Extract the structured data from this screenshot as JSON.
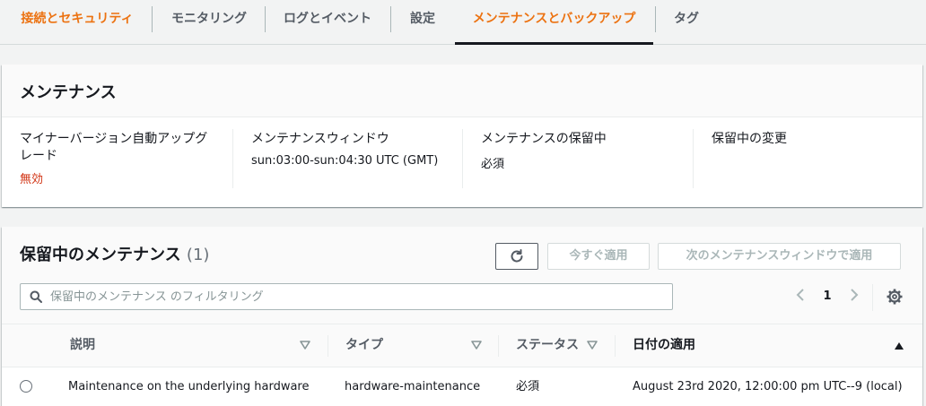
{
  "tabs": [
    {
      "label": "接続とセキュリティ"
    },
    {
      "label": "モニタリング"
    },
    {
      "label": "ログとイベント"
    },
    {
      "label": "設定"
    },
    {
      "label": "メンテナンスとバックアップ"
    },
    {
      "label": "タグ"
    }
  ],
  "maintenance": {
    "title": "メンテナンス",
    "fields": [
      {
        "label": "マイナーバージョン自動アップグレード",
        "label_line1": "マイナーバージョン自動アップグ",
        "label_line2": "レード",
        "value": "無効"
      },
      {
        "label": "メンテナンスウィンドウ",
        "value": "sun:03:00-sun:04:30 UTC (GMT)"
      },
      {
        "label": "メンテナンスの保留中",
        "value": "必須"
      },
      {
        "label": "保留中の変更",
        "value": ""
      }
    ]
  },
  "pending": {
    "title": "保留中のメンテナンス",
    "count": "(1)",
    "apply_now_label": "今すぐ適用",
    "apply_next_label": "次のメンテナンスウィンドウで適用",
    "search_placeholder": "保留中のメンテナンス のフィルタリング",
    "page": "1",
    "columns": [
      "説明",
      "タイプ",
      "ステータス",
      "日付の適用"
    ],
    "rows": [
      {
        "description": "Maintenance on the underlying hardware",
        "type": "hardware-maintenance",
        "status": "必須",
        "apply_date": "August 23rd 2020, 12:00:00 pm UTC--9 (local)"
      }
    ]
  },
  "icons": {
    "refresh": "refresh-icon",
    "search": "search-icon",
    "prev": "chevron-left-icon",
    "next": "chevron-right-icon",
    "settings": "gear-icon"
  },
  "colors": {
    "accent": "#ec7211",
    "disabled_red": "#d13212"
  }
}
